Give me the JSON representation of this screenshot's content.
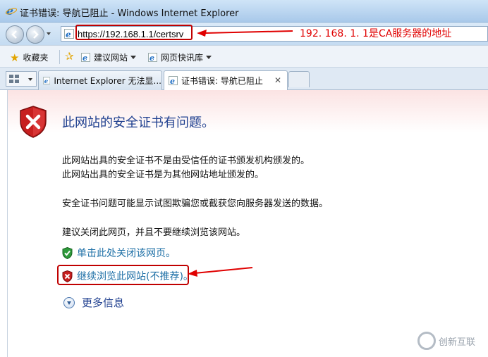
{
  "window": {
    "title": "证书错误: 导航已阻止 - Windows Internet Explorer"
  },
  "navbar": {
    "url": "https://192.168.1.1/certsrv"
  },
  "annotations": {
    "address_note": "192. 168. 1. 1是CA服务器的地址"
  },
  "favorites_bar": {
    "favorites_label": "收藏夹",
    "suggested_sites": "建议网站",
    "web_slice": "网页快讯库"
  },
  "tabs": [
    {
      "label": "Internet Explorer 无法显..."
    },
    {
      "label": "证书错误: 导航已阻止",
      "close": "✕"
    }
  ],
  "content": {
    "headline": "此网站的安全证书有问题。",
    "line1": "此网站出具的安全证书不是由受信任的证书颁发机构颁发的。",
    "line2": "此网站出具的安全证书是为其他网站地址颁发的。",
    "line3": "安全证书问题可能显示试图欺骗您或截获您向服务器发送的数据。",
    "line4": "建议关闭此网页，并且不要继续浏览该网站。",
    "close_link": "单击此处关闭该网页。",
    "continue_link": "继续浏览此网站(不推荐)。",
    "more_info": "更多信息"
  },
  "watermark": {
    "text": "创新互联"
  },
  "colors": {
    "annotation_red": "#e00000",
    "link_blue": "#1d6fa6",
    "headline_blue": "#1f3f8f"
  }
}
